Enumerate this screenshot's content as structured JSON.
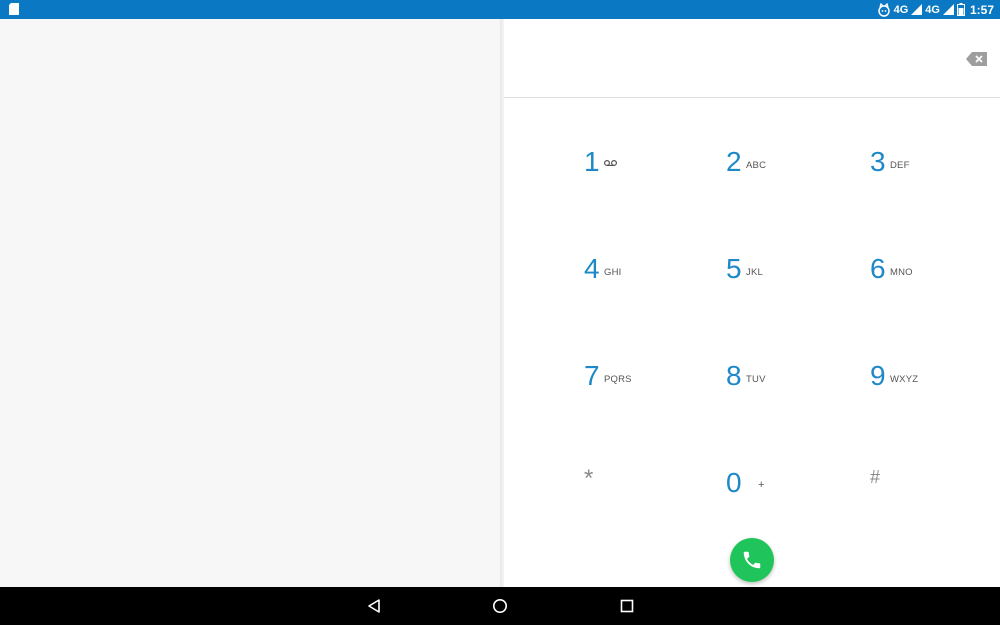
{
  "status_bar": {
    "network_1": "4G",
    "network_2": "4G",
    "time": "1:57",
    "icons": [
      "sd-card-icon",
      "cat-notification-icon",
      "signal-icon",
      "battery-icon"
    ]
  },
  "dialer": {
    "digits": "",
    "backspace_icon": "backspace-icon",
    "keys": [
      {
        "digit": "1",
        "letters": "",
        "icon": "voicemail-icon"
      },
      {
        "digit": "2",
        "letters": "ABC"
      },
      {
        "digit": "3",
        "letters": "DEF"
      },
      {
        "digit": "4",
        "letters": "GHI"
      },
      {
        "digit": "5",
        "letters": "JKL"
      },
      {
        "digit": "6",
        "letters": "MNO"
      },
      {
        "digit": "7",
        "letters": "PQRS"
      },
      {
        "digit": "8",
        "letters": "TUV"
      },
      {
        "digit": "9",
        "letters": "WXYZ"
      },
      {
        "digit": "*",
        "letters": ""
      },
      {
        "digit": "0",
        "letters": "+"
      },
      {
        "digit": "#",
        "letters": ""
      }
    ],
    "call_icon": "phone-icon",
    "accent_color": "#1e88c8",
    "call_color": "#1fc55a"
  },
  "nav_bar": {
    "icons": [
      "back-icon",
      "home-icon",
      "recents-icon"
    ]
  },
  "colors": {
    "status_bar": "#0a78c2",
    "nav_bar": "#000000"
  }
}
